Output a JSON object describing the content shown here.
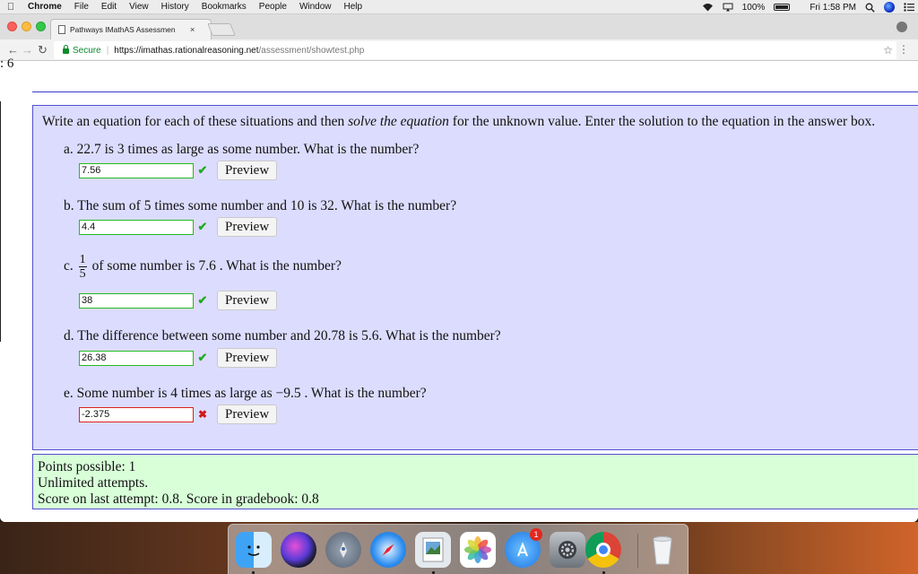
{
  "menubar": {
    "app": "Chrome",
    "items": [
      "File",
      "Edit",
      "View",
      "History",
      "Bookmarks",
      "People",
      "Window",
      "Help"
    ],
    "battery": "100%",
    "clock": "Fri 1:58 PM"
  },
  "browser": {
    "tab_title": "Pathways IMathAS Assessmen",
    "tab_close": "×",
    "secure_label": "Secure",
    "url_host": "https://imathas.rationalreasoning.net",
    "url_path": "/assessment/showtest.php"
  },
  "page": {
    "question_number": ": 6",
    "prompt_before": "Write an equation for each of these situations and then ",
    "prompt_em": "solve the equation",
    "prompt_after": " for the unknown value. Enter the solution to the equation in the answer box.",
    "preview_label": "Preview",
    "parts": [
      {
        "text": "a. 22.7 is 3 times as large as some number. What is the number?",
        "answer": "7.56",
        "status": "correct"
      },
      {
        "text": "b. The sum of 5 times some number and 10 is 32. What is the number?",
        "answer": "4.4",
        "status": "correct"
      },
      {
        "prefix": "c.",
        "frac_num": "1",
        "frac_den": "5",
        "text": "of some number is 7.6 . What is the number?",
        "answer": "38",
        "status": "correct"
      },
      {
        "text": "d. The difference between some number and 20.78 is 5.6. What is the number?",
        "answer": "26.38",
        "status": "correct"
      },
      {
        "text": "e. Some number is 4 times as large as −9.5 . What is the number?",
        "answer": "-2.375",
        "status": "incorrect"
      }
    ],
    "info": {
      "points": "Points possible: 1",
      "attempts": "Unlimited attempts.",
      "score": "Score on last attempt: 0.8. Score in gradebook: 0.8"
    }
  },
  "dock": {
    "apps": [
      "finder-icon",
      "siri-icon",
      "launchpad-icon",
      "safari-icon",
      "preview-icon",
      "photos-icon",
      "app-store-icon",
      "system-preferences-icon",
      "chrome-icon",
      "trash-icon"
    ],
    "app_store_badge": "1"
  },
  "colors": {
    "question_bg": "#dcdcff",
    "info_bg": "#d9ffd9",
    "border_blue": "#5050d0",
    "correct_green": "#22aa22",
    "incorrect_red": "#d01818"
  }
}
